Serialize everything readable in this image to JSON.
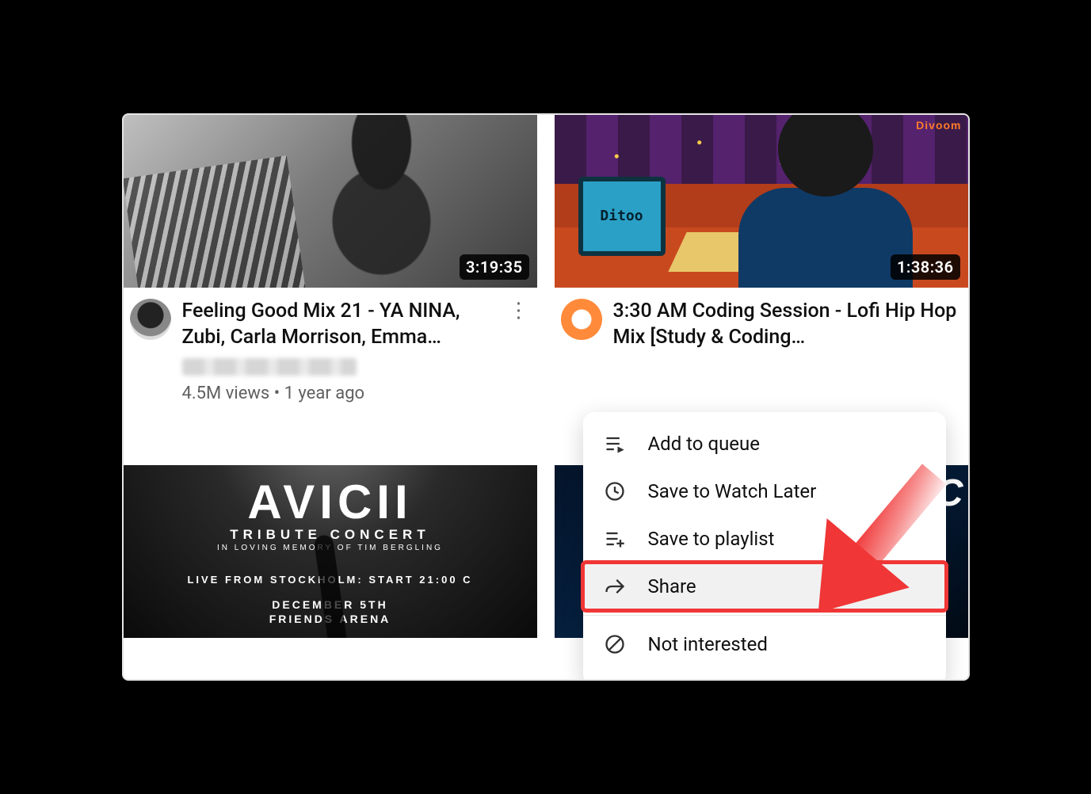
{
  "videos": [
    {
      "duration": "3:19:35",
      "title": "Feeling Good Mix 21 - YA NINA, Zubi, Carla Morrison, Emma…",
      "stats": "4.5M views  •  1 year ago"
    },
    {
      "duration": "1:38:36",
      "title": "3:30 AM Coding Session - Lofi Hip Hop Mix [Study & Coding…",
      "monitor_label": "Ditoo",
      "brand": "Divoom"
    },
    {
      "poster": {
        "logo": "AVICII",
        "sub1": "TRIBUTE CONCERT",
        "sub2": "IN LOVING MEMORY OF TIM BERGLING",
        "live": "LIVE FROM STOCKHOLM: START 21:00 C",
        "date": "DECEMBER 5TH",
        "arena": "FRIENDS ARENA"
      }
    },
    {
      "partial_text": "SIC"
    }
  ],
  "menu": {
    "items": [
      {
        "icon": "queue",
        "label": "Add to queue"
      },
      {
        "icon": "clock",
        "label": "Save to Watch Later"
      },
      {
        "icon": "playlist",
        "label": "Save to playlist"
      },
      {
        "icon": "share",
        "label": "Share",
        "highlight": true
      },
      {
        "divider": true
      },
      {
        "icon": "block",
        "label": "Not interested"
      }
    ]
  }
}
